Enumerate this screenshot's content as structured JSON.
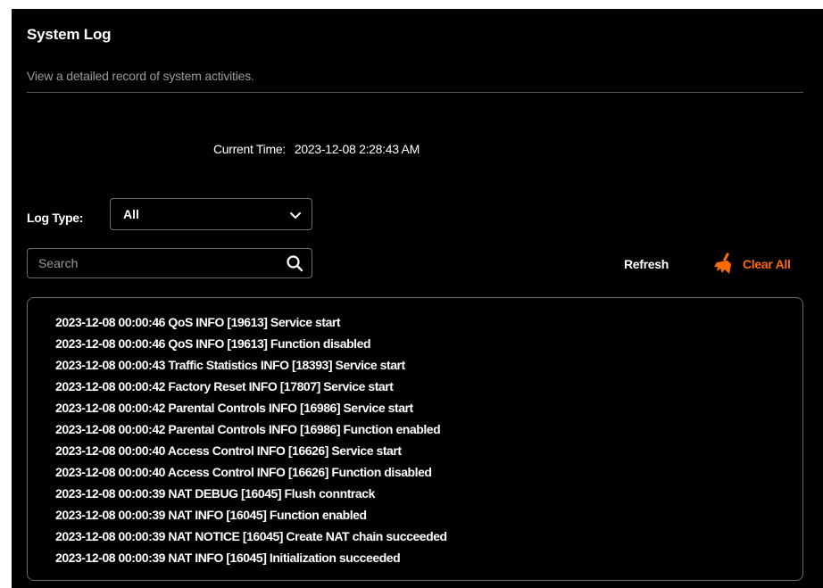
{
  "header": {
    "title": "System Log",
    "description": "View a detailed record of system activities."
  },
  "current_time": {
    "label": "Current Time:",
    "value": "2023-12-08 2:28:43 AM"
  },
  "log_type": {
    "label": "Log Type:",
    "selected": "All"
  },
  "search": {
    "placeholder": "Search",
    "value": ""
  },
  "actions": {
    "refresh_label": "Refresh",
    "clear_all_label": "Clear All"
  },
  "colors": {
    "background": "#000000",
    "accent": "#ff6a00",
    "border": "#6a6a6a",
    "muted_text": "#9a9a9a"
  },
  "icons": {
    "select": "chevron-down-icon",
    "search": "search-icon",
    "clear_all": "broom-icon"
  },
  "logs": [
    "2023-12-08 00:00:46 QoS INFO [19613] Service start",
    "2023-12-08 00:00:46 QoS INFO [19613] Function disabled",
    "2023-12-08 00:00:43 Traffic Statistics INFO [18393] Service start",
    "2023-12-08 00:00:42 Factory Reset INFO [17807] Service start",
    "2023-12-08 00:00:42 Parental Controls INFO [16986] Service start",
    "2023-12-08 00:00:42 Parental Controls INFO [16986] Function enabled",
    "2023-12-08 00:00:40 Access Control INFO [16626] Service start",
    "2023-12-08 00:00:40 Access Control INFO [16626] Function disabled",
    "2023-12-08 00:00:39 NAT DEBUG [16045] Flush conntrack",
    "2023-12-08 00:00:39 NAT INFO [16045] Function enabled",
    "2023-12-08 00:00:39 NAT NOTICE [16045] Create NAT chain succeeded",
    "2023-12-08 00:00:39 NAT INFO [16045] Initialization succeeded"
  ]
}
